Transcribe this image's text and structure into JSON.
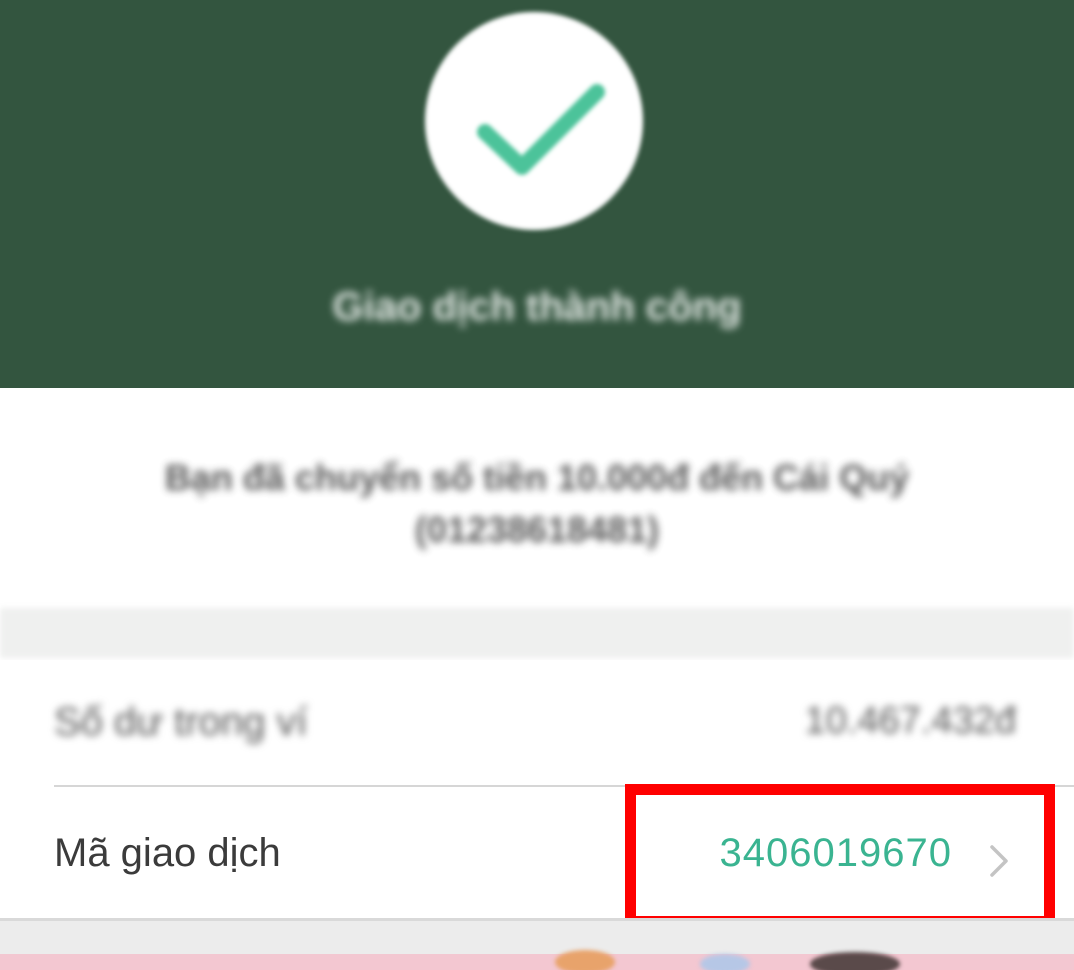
{
  "header": {
    "status_title": "Giao dịch thành công",
    "icon": "check-icon",
    "background_color": "#33553f",
    "check_color": "#4cc39a"
  },
  "message": {
    "line1": "Bạn đã chuyển số tiền 10.000đ đến Cái Quý",
    "line2": "(01238618481)"
  },
  "details": {
    "balance": {
      "label": "Số dư trong ví",
      "value": "10.467.432đ"
    },
    "transaction": {
      "label": "Mã giao dịch",
      "value": "3406019670",
      "value_color": "#3ab491",
      "icon": "chevron-right-icon"
    }
  },
  "annotation": {
    "highlight_color": "#ff0000"
  }
}
